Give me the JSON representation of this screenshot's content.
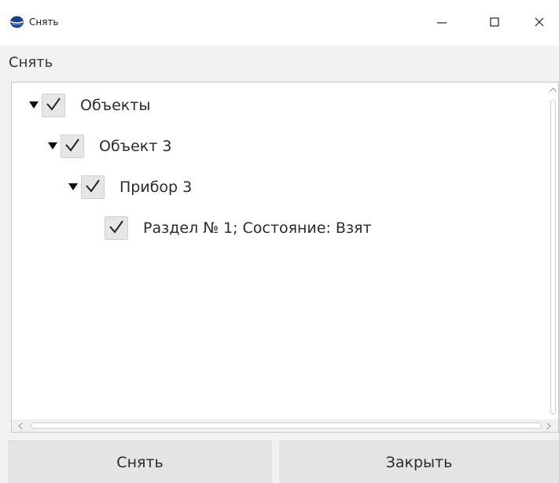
{
  "window": {
    "title": "Снять",
    "icon": "app-globe-icon",
    "controls": {
      "minimize_icon": "minimize-icon",
      "maximize_icon": "maximize-icon",
      "close_icon": "close-icon"
    }
  },
  "section_label": "Снять",
  "tree": {
    "nodes": [
      {
        "label": "Объекты",
        "checked": true,
        "expanded": true,
        "level": 0
      },
      {
        "label": "Объект 3",
        "checked": true,
        "expanded": true,
        "level": 1
      },
      {
        "label": "Прибор 3",
        "checked": true,
        "expanded": true,
        "level": 2
      },
      {
        "label": "Раздел № 1; Состояние: Взят",
        "checked": true,
        "expanded": false,
        "level": 3
      }
    ]
  },
  "buttons": {
    "remove_label": "Снять",
    "close_label": "Закрыть"
  },
  "colors": {
    "accent_icon": "#1e3f8f",
    "button_bg": "#e4e4e4",
    "checkbox_bg": "#e6e6e6"
  }
}
